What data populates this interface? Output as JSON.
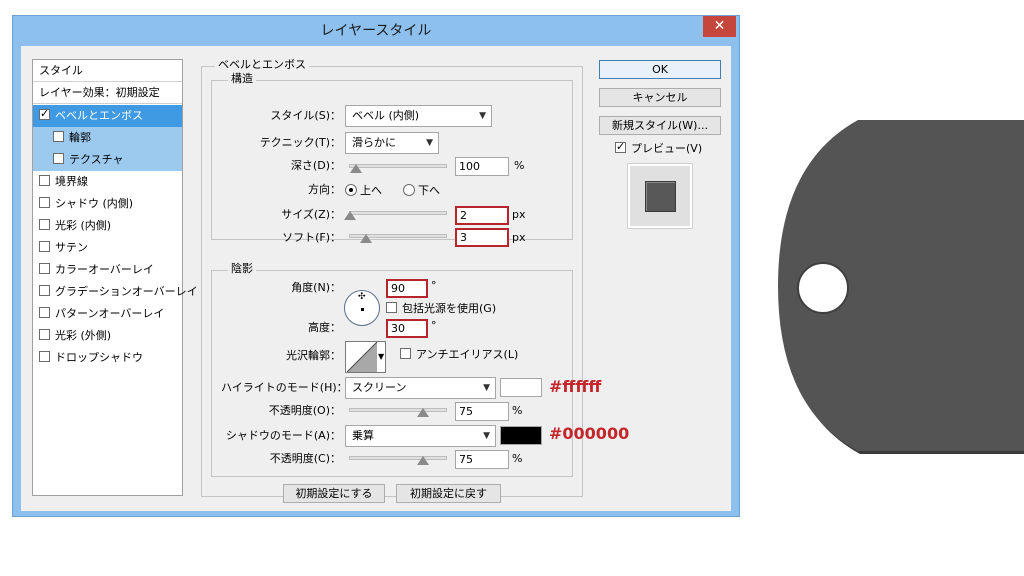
{
  "window": {
    "title": "レイヤースタイル",
    "close_glyph": "✕"
  },
  "styles_panel": {
    "header": "スタイル",
    "blend": "レイヤー効果：初期設定",
    "items": [
      {
        "label": "ベベルとエンボス",
        "checked": true,
        "selected": true
      },
      {
        "label": "輪郭",
        "checked": false,
        "sub": true
      },
      {
        "label": "テクスチャ",
        "checked": false,
        "sub": true
      },
      {
        "label": "境界線",
        "checked": false
      },
      {
        "label": "シャドウ (内側)",
        "checked": false
      },
      {
        "label": "光彩 (内側)",
        "checked": false
      },
      {
        "label": "サテン",
        "checked": false
      },
      {
        "label": "カラーオーバーレイ",
        "checked": false
      },
      {
        "label": "グラデーションオーバーレイ",
        "checked": false
      },
      {
        "label": "パターンオーバーレイ",
        "checked": false
      },
      {
        "label": "光彩 (外側)",
        "checked": false
      },
      {
        "label": "ドロップシャドウ",
        "checked": false
      }
    ]
  },
  "bevel": {
    "group_title": "ベベルとエンボス",
    "structure_title": "構造",
    "style_label": "スタイル(S)：",
    "style_value": "ベベル (内側)",
    "technique_label": "テクニック(T)：",
    "technique_value": "滑らかに",
    "depth_label": "深さ(D)：",
    "depth_value": "100",
    "depth_unit": "%",
    "direction_label": "方向：",
    "direction_up": "上へ",
    "direction_down": "下へ",
    "size_label": "サイズ(Z)：",
    "size_value": "2",
    "size_unit": "px",
    "soften_label": "ソフト(F)：",
    "soften_value": "3",
    "soften_unit": "px"
  },
  "shading": {
    "title": "陰影",
    "angle_label": "角度(N)：",
    "angle_value": "90",
    "angle_unit": "°",
    "global_light_label": "包括光源を使用(G)",
    "altitude_label": "高度：",
    "altitude_value": "30",
    "altitude_unit": "°",
    "gloss_label": "光沢輪郭：",
    "antialias_label": "アンチエイリアス(L)",
    "highlight_mode_label": "ハイライトのモード(H)：",
    "highlight_mode_value": "スクリーン",
    "highlight_color": "#ffffff",
    "highlight_hex": "#ffffff",
    "highlight_opacity_label": "不透明度(O)：",
    "highlight_opacity_value": "75",
    "highlight_opacity_unit": "%",
    "shadow_mode_label": "シャドウのモード(A)：",
    "shadow_mode_value": "乗算",
    "shadow_color": "#000000",
    "shadow_hex": "#000000",
    "shadow_opacity_label": "不透明度(C)：",
    "shadow_opacity_value": "75",
    "shadow_opacity_unit": "%"
  },
  "bottom_buttons": {
    "make_default": "初期設定にする",
    "reset_default": "初期設定に戻す"
  },
  "right_buttons": {
    "ok": "OK",
    "cancel": "キャンセル",
    "new_style": "新規スタイル(W)...",
    "preview": "プレビュー(V)",
    "preview_checked": true
  },
  "colors": {
    "tag_fill": "#545454",
    "accent_red": "#c3262b",
    "selection": "#3f9ae3"
  }
}
